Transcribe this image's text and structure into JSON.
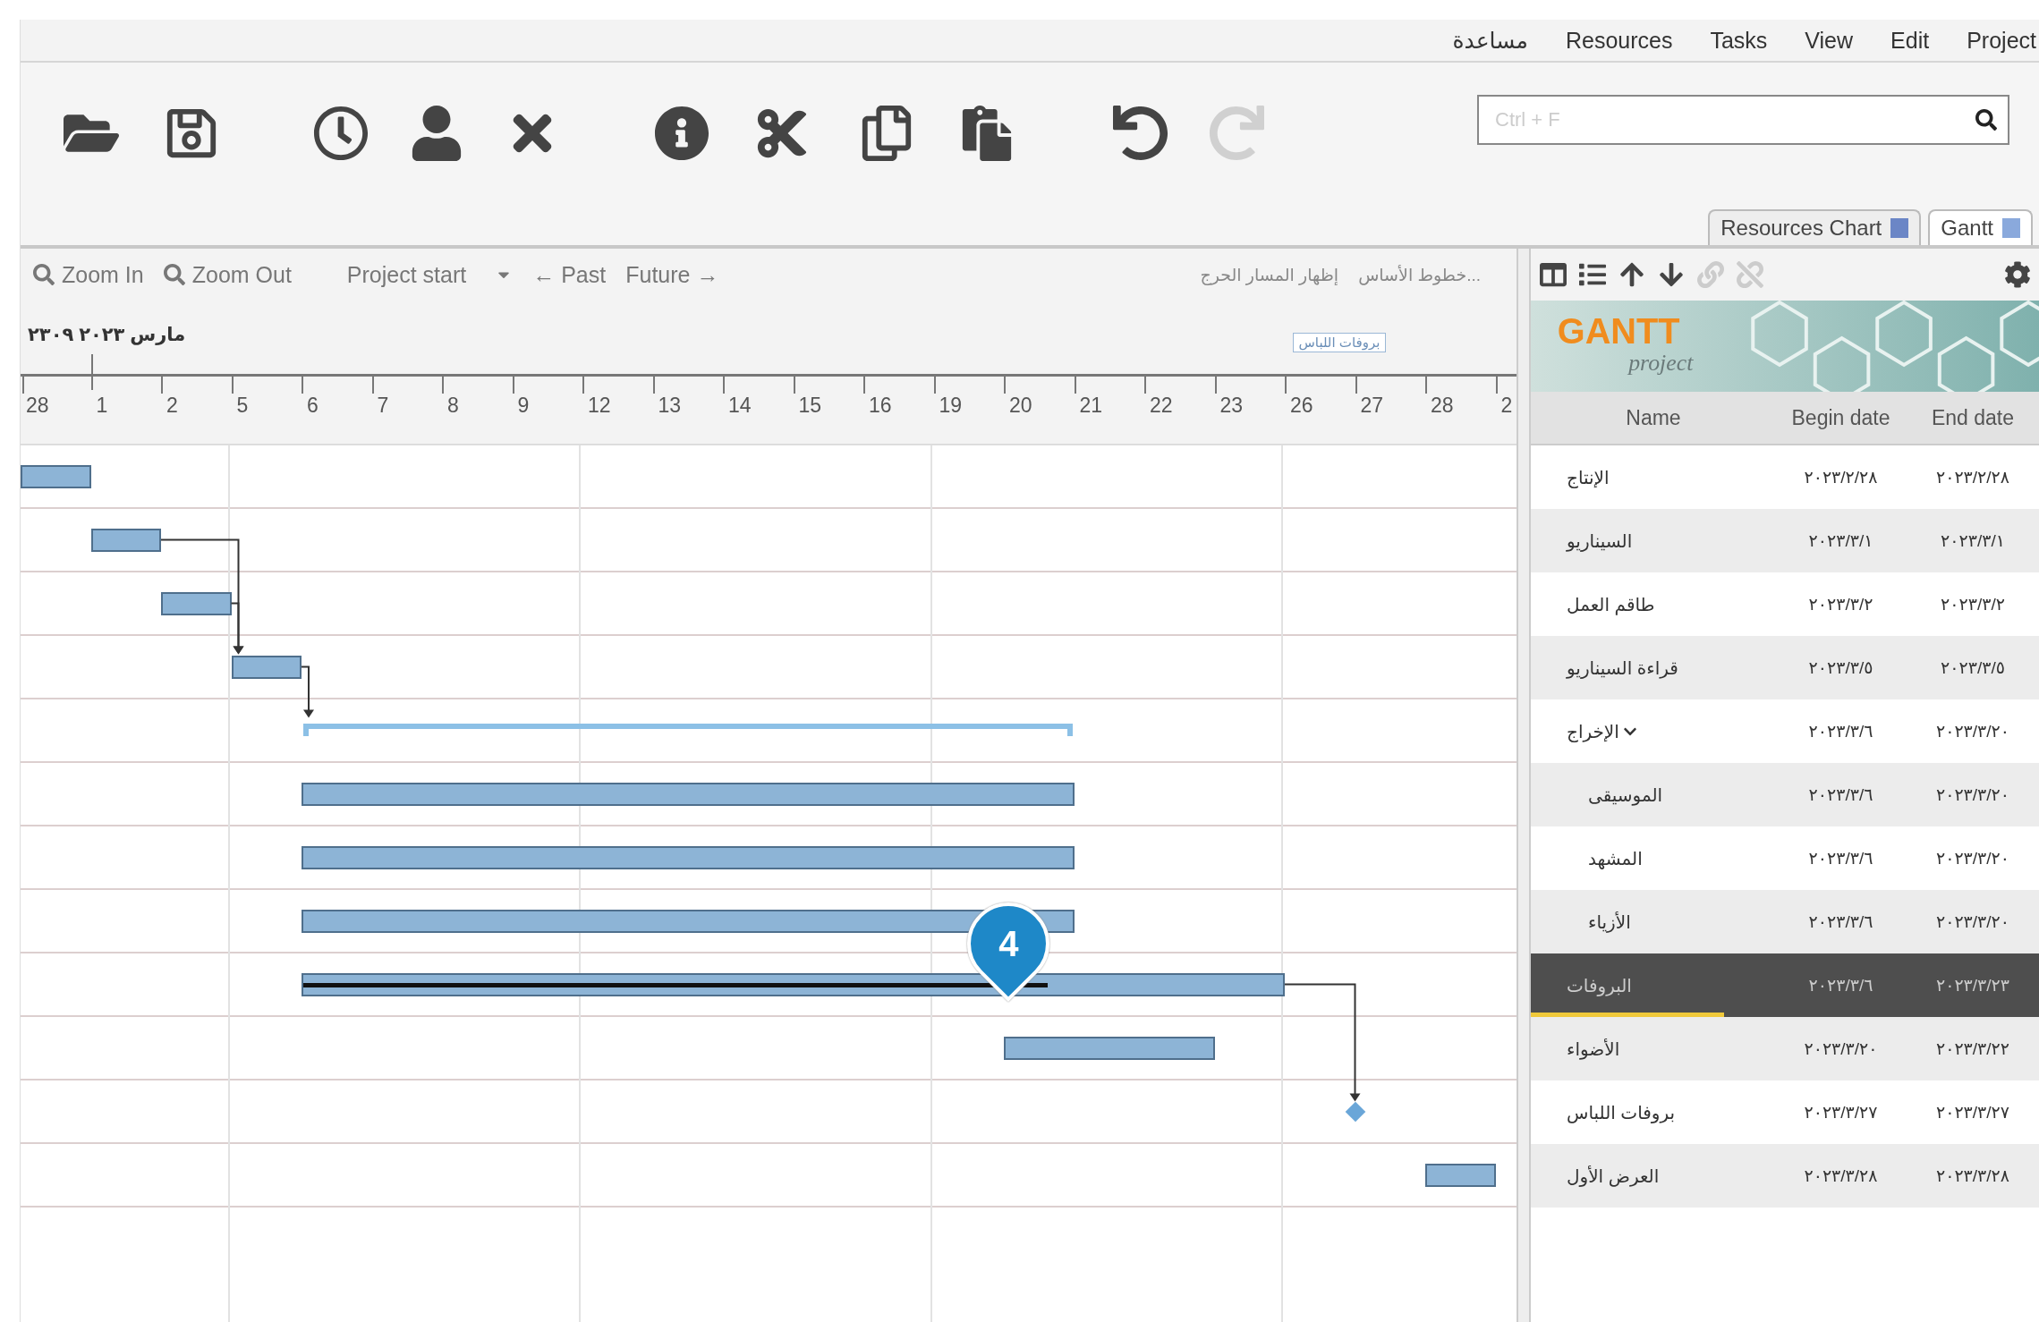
{
  "menu": [
    {
      "label": "Project"
    },
    {
      "label": "Edit"
    },
    {
      "label": "View"
    },
    {
      "label": "Tasks"
    },
    {
      "label": "Resources"
    },
    {
      "label": "مساعدة"
    }
  ],
  "toolbar": [
    {
      "kind": "open",
      "disabled": false
    },
    {
      "kind": "save",
      "disabled": false
    },
    {
      "kind": "history",
      "disabled": false
    },
    {
      "kind": "person",
      "disabled": false
    },
    {
      "kind": "delete",
      "disabled": false
    },
    {
      "kind": "info",
      "disabled": false
    },
    {
      "kind": "cut",
      "disabled": false
    },
    {
      "kind": "copy",
      "disabled": false
    },
    {
      "kind": "paste",
      "disabled": false
    },
    {
      "kind": "undo",
      "disabled": false
    },
    {
      "kind": "redo",
      "disabled": true
    }
  ],
  "search": {
    "placeholder": "Ctrl + F"
  },
  "view_tabs": [
    {
      "label": "Gantt",
      "selected": true
    },
    {
      "label": "Resources Chart",
      "selected": false
    }
  ],
  "gantt_toolbar": {
    "zoom_in": "Zoom In",
    "zoom_out": "Zoom Out",
    "project_start": "Project start",
    "past": "← Past",
    "future": "Future →",
    "critical_path": "إظهار المسار الحرج",
    "baselines": "خطوط الأساس..."
  },
  "timeline": {
    "month": "مارس ٢٠٢٣ ٢٣٠٩",
    "milestone_label": "بروفات اللباس",
    "days": [
      "2",
      "28",
      "27",
      "26",
      "23",
      "22",
      "21",
      "20",
      "19",
      "16",
      "15",
      "14",
      "13",
      "12",
      "9",
      "8",
      "7",
      "6",
      "5",
      "2",
      "1",
      "28"
    ]
  },
  "table_toolbar": [
    {
      "kind": "columns",
      "disabled": false
    },
    {
      "kind": "list",
      "disabled": false
    },
    {
      "kind": "up",
      "disabled": false
    },
    {
      "kind": "down",
      "disabled": false
    },
    {
      "kind": "link",
      "disabled": true
    },
    {
      "kind": "unlink",
      "disabled": true
    },
    {
      "kind": "settings",
      "disabled": false
    }
  ],
  "logo": {
    "title": "GANTT",
    "subtitle": "project"
  },
  "columns": [
    "End date",
    "Begin date",
    "Name"
  ],
  "tasks": [
    {
      "name": "الإنتاج",
      "begin": "٢٠٢٣/٢/٢٨",
      "end": "٢٠٢٣/٢/٢٨",
      "kind": "task",
      "selected": false
    },
    {
      "name": "السيناريو",
      "begin": "٢٠٢٣/٣/١",
      "end": "٢٠٢٣/٣/١",
      "kind": "task",
      "selected": false,
      "link_out": true
    },
    {
      "name": "طاقم العمل",
      "begin": "٢٠٢٣/٣/٢",
      "end": "٢٠٢٣/٣/٢",
      "kind": "task",
      "selected": false,
      "link_out": true
    },
    {
      "name": "قراءة السيناريو",
      "begin": "٢٠٢٣/٣/٥",
      "end": "٢٠٢٣/٣/٥",
      "kind": "task",
      "selected": false,
      "link_in": true,
      "link_out": true
    },
    {
      "name": "الإخراج",
      "begin": "٢٠٢٣/٣/٦",
      "end": "٢٠٢٣/٣/٢٠",
      "kind": "summary",
      "selected": false,
      "expanded": true,
      "link_in": true,
      "children": [
        {
          "name": "الموسيقى",
          "begin": "٢٠٢٣/٣/٦",
          "end": "٢٠٢٣/٣/٢٠",
          "kind": "task",
          "selected": false
        },
        {
          "name": "المشهد",
          "begin": "٢٠٢٣/٣/٦",
          "end": "٢٠٢٣/٣/٢٠",
          "kind": "task",
          "selected": false
        },
        {
          "name": "الأزياء",
          "begin": "٢٠٢٣/٣/٦",
          "end": "٢٠٢٣/٣/٢٠",
          "kind": "task",
          "selected": false
        }
      ]
    },
    {
      "name": "البروفات",
      "begin": "٢٠٢٣/٣/٦",
      "end": "٢٠٢٣/٣/٢٣",
      "kind": "task",
      "selected": true,
      "level": 0.76,
      "link_out": true
    },
    {
      "name": "الأضواء",
      "begin": "٢٠٢٣/٣/٢٠",
      "end": "٢٠٢٣/٣/٢٢",
      "kind": "task",
      "selected": false
    },
    {
      "name": "بروفات اللباس",
      "begin": "٢٠٢٣/٣/٢٧",
      "end": "٢٠٢٣/٣/٢٧",
      "kind": "milestone",
      "selected": false,
      "link_in": true
    },
    {
      "name": "العرض الأول",
      "begin": "٢٠٢٣/٣/٢٨",
      "end": "٢٠٢٣/٣/٢٨",
      "kind": "task",
      "selected": false
    }
  ],
  "callout": {
    "label": "4"
  }
}
